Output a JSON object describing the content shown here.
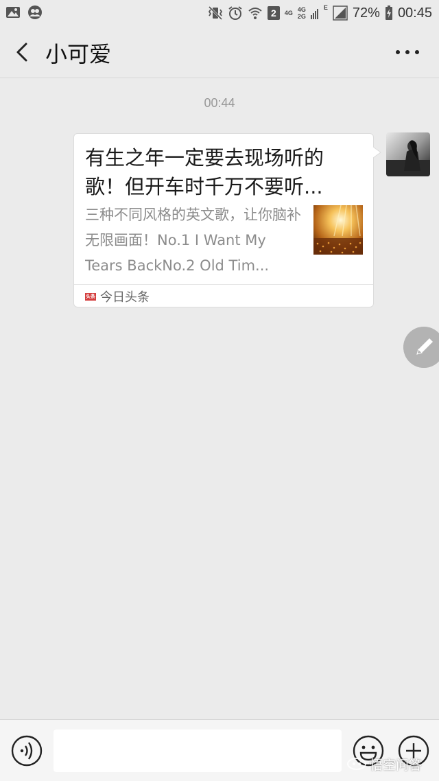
{
  "status_bar": {
    "sim_badge": "2",
    "net1_top": "4G",
    "net2_top": "4G",
    "net2_bottom": "2G",
    "edge": "E",
    "battery": "72%",
    "time": "00:45"
  },
  "header": {
    "title": "小可爱"
  },
  "chat": {
    "timestamp": "00:44",
    "message": {
      "title": "有生之年一定要去现场听的歌！但开车时千万不要听...",
      "description": "三种不同风格的英文歌，让你脑补无限画面！No.1 I Want My Tears BackNo.2 Old Tim...",
      "source_logo": "头条",
      "source_name": "今日头条"
    }
  },
  "watermark": {
    "text": "悟空问答"
  },
  "colors": {
    "background": "#ebebeb",
    "card": "#ffffff",
    "source_red": "#d43d3d",
    "fab": "#b3b3b3"
  }
}
